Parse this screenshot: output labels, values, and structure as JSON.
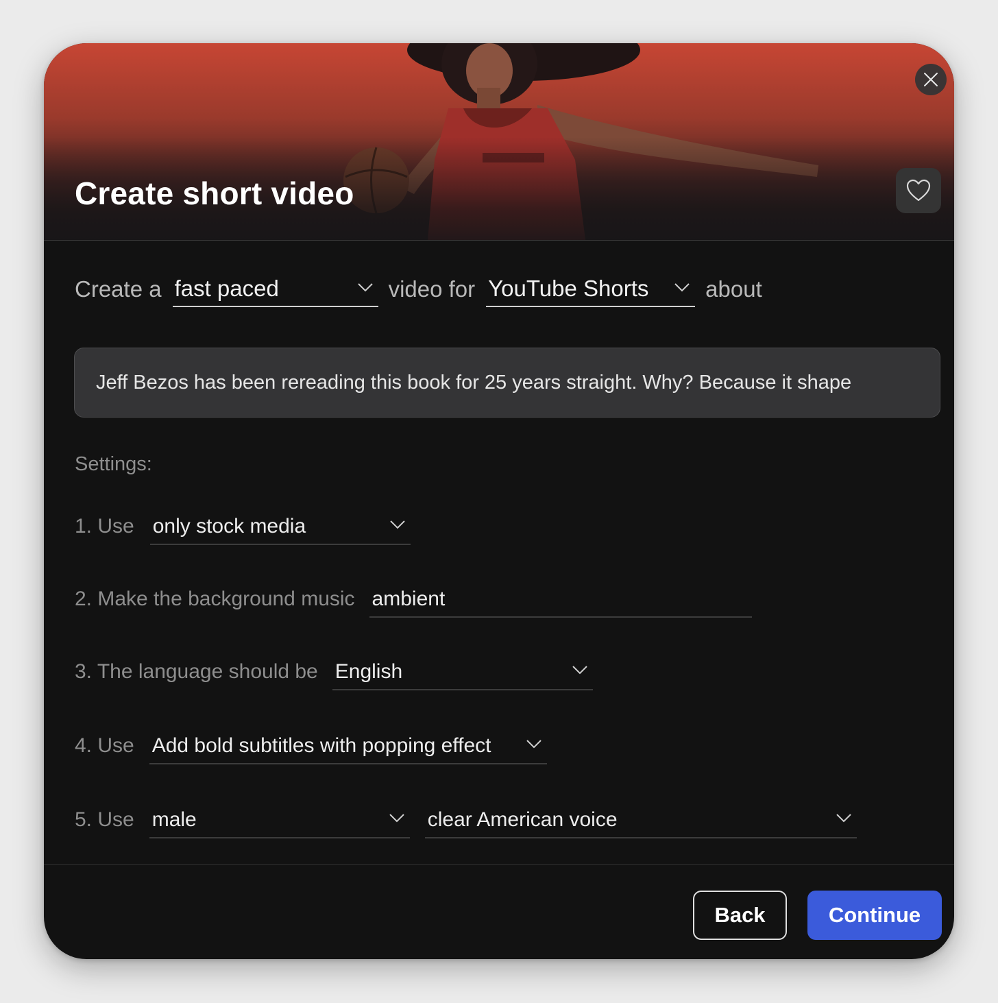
{
  "modal": {
    "title": "Create short video",
    "close_icon": "close-icon",
    "favorite_icon": "heart-icon"
  },
  "prompt": {
    "prefix": "Create a",
    "pace": {
      "value": "fast paced"
    },
    "middle": "video for",
    "platform": {
      "value": "YouTube Shorts"
    },
    "suffix": "about",
    "topic": "Jeff Bezos has been rereading this book for 25 years straight. Why? Because it shape"
  },
  "settings": {
    "label": "Settings:",
    "media": {
      "label": "1. Use",
      "value": "only stock media"
    },
    "music": {
      "label": "2. Make the background music",
      "value": "ambient"
    },
    "language": {
      "label": "3. The language should be",
      "value": "English"
    },
    "subtitles": {
      "label": "4. Use",
      "value": "Add bold subtitles with popping effect"
    },
    "voice": {
      "label": "5. Use",
      "gender": "male",
      "style": "clear American voice"
    }
  },
  "footer": {
    "back_label": "Back",
    "continue_label": "Continue"
  },
  "colors": {
    "accent": "#3b5bdb",
    "modal_bg": "#121212",
    "hero_top": "#c74634"
  }
}
